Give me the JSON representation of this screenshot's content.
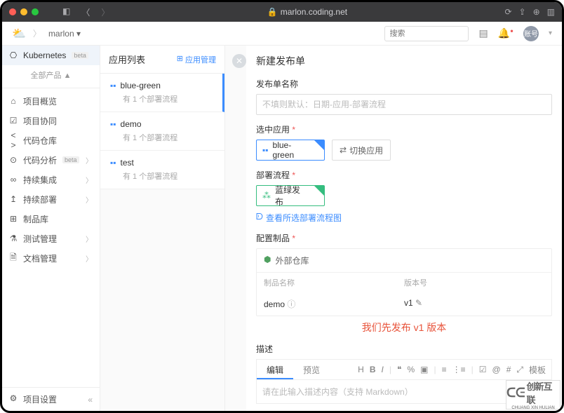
{
  "browser": {
    "url": "marlon.coding.net"
  },
  "topbar": {
    "project": "marlon",
    "search_placeholder": "搜索",
    "avatar": "账号"
  },
  "sidebar1": {
    "kubernetes": "Kubernetes",
    "kubernetes_beta": "beta",
    "all_products": "全部产品 ▲",
    "items": [
      {
        "icon": "⌂",
        "label": "项目概览"
      },
      {
        "icon": "☑",
        "label": "项目协同"
      },
      {
        "icon": "< >",
        "label": "代码仓库"
      },
      {
        "icon": "⊙",
        "label": "代码分析",
        "beta": "beta",
        "chev": true
      },
      {
        "icon": "∞",
        "label": "持续集成",
        "chev": true
      },
      {
        "icon": "↥",
        "label": "持续部署",
        "chev": true
      },
      {
        "icon": "⊞",
        "label": "制品库"
      },
      {
        "icon": "⚗",
        "label": "测试管理",
        "chev": true
      },
      {
        "icon": "🗎",
        "label": "文档管理",
        "chev": true
      }
    ],
    "settings": "项目设置"
  },
  "sidebar2": {
    "title": "应用列表",
    "manage": "应用管理",
    "apps": [
      {
        "name": "blue-green",
        "sub": "有 1 个部署流程",
        "active": true
      },
      {
        "name": "demo",
        "sub": "有 1 个部署流程"
      },
      {
        "name": "test",
        "sub": "有 1 个部署流程"
      }
    ]
  },
  "form": {
    "title": "新建发布单",
    "name_label": "发布单名称",
    "name_placeholder": "不填则默认：日期-应用-部署流程",
    "app_label": "选中应用",
    "app_value": "blue-green",
    "switch_app": "切换应用",
    "flow_label": "部署流程",
    "flow_value": "蓝绿发布",
    "view_flow": "查看所选部署流程图",
    "artifacts_label": "配置制品",
    "repo": "外部仓库",
    "col_name": "制品名称",
    "col_version": "版本号",
    "row_name": "demo",
    "row_version": "v1",
    "annotation": "我们先发布 v1 版本",
    "desc_label": "描述",
    "tab_edit": "编辑",
    "tab_preview": "预览",
    "template": "模板",
    "desc_placeholder": "请在此输入描述内容（支持 Markdown）"
  },
  "watermark": {
    "big": "创新互联",
    "small": "CHUANG XIN HULIAN"
  }
}
